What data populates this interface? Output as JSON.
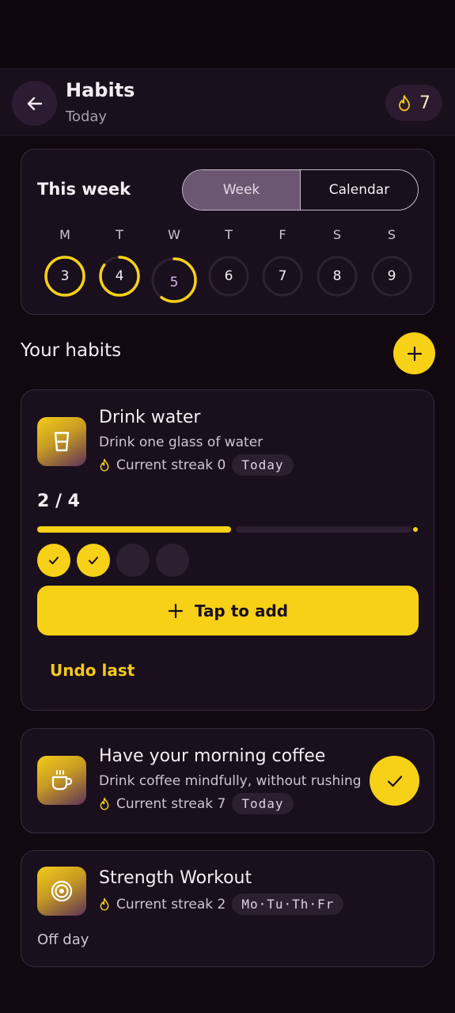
{
  "header": {
    "title": "Habits",
    "subtitle": "Today",
    "streak_count": "7",
    "back_icon": "arrow-left-icon",
    "streak_icon": "flame-icon"
  },
  "week": {
    "title": "This week",
    "toggle": {
      "week_label": "Week",
      "calendar_label": "Calendar",
      "selected": "Week"
    },
    "days": [
      {
        "letter": "M",
        "date": "3",
        "progress": 1.0,
        "today": false
      },
      {
        "letter": "T",
        "date": "4",
        "progress": 0.85,
        "today": false
      },
      {
        "letter": "W",
        "date": "5",
        "progress": 0.6,
        "today": true
      },
      {
        "letter": "T",
        "date": "6",
        "progress": 0,
        "today": false
      },
      {
        "letter": "F",
        "date": "7",
        "progress": 0,
        "today": false
      },
      {
        "letter": "S",
        "date": "8",
        "progress": 0,
        "today": false
      },
      {
        "letter": "S",
        "date": "9",
        "progress": 0,
        "today": false
      }
    ]
  },
  "habits_section": {
    "title": "Your habits",
    "add_icon": "plus-icon"
  },
  "habits": [
    {
      "title": "Drink water",
      "description": "Drink one glass of water",
      "streak_text": "Current streak 0",
      "schedule_chip": "Today",
      "icon": "glass-icon",
      "progress_text": "2 / 4",
      "progress_done": 2,
      "progress_total": 4,
      "tap_label": "Tap to add",
      "undo_label": "Undo last"
    },
    {
      "title": "Have your morning coffee",
      "description": "Drink coffee mindfully, without rushing",
      "streak_text": "Current streak 7",
      "schedule_chip": "Today",
      "icon": "coffee-cup-icon",
      "completed": true
    },
    {
      "title": "Strength Workout",
      "streak_text": "Current streak 2",
      "schedule_chip": "Mo·Tu·Th·Fr",
      "icon": "target-icon",
      "status_text": "Off day"
    }
  ],
  "colors": {
    "background": "#110810",
    "card": "#1a0f1c",
    "accent": "#f7d117",
    "today_number": "#d8b3ec"
  }
}
